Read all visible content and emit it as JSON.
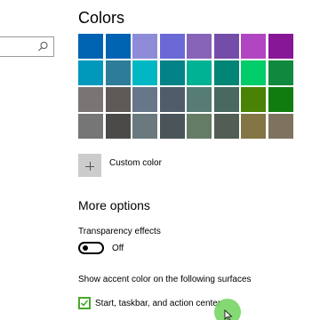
{
  "search": {
    "placeholder": "",
    "value": ""
  },
  "colors": {
    "title": "Colors",
    "swatches": [
      "#0063b1",
      "#0063b1",
      "#8e8cd8",
      "#6b69d6",
      "#8764b8",
      "#744da9",
      "#b146c2",
      "#881798",
      "#0099bc",
      "#2d7d9a",
      "#00b7c3",
      "#038387",
      "#00b294",
      "#018574",
      "#00cc6a",
      "#10893e",
      "#7a7574",
      "#5d5a58",
      "#68768a",
      "#515c6b",
      "#567c73",
      "#486860",
      "#498205",
      "#107c10",
      "#767676",
      "#4c4a48",
      "#69797e",
      "#4a5459",
      "#647c64",
      "#525e54",
      "#847545",
      "#7e735f"
    ],
    "selected_index": null
  },
  "custom_color": {
    "label": "Custom color"
  },
  "more_options": {
    "title": "More options",
    "transparency": {
      "label": "Transparency effects",
      "state_label": "Off",
      "on": false
    },
    "accent_surfaces": {
      "label": "Show accent color on the following surfaces",
      "start_taskbar": {
        "label": "Start, taskbar, and action center",
        "checked": true
      }
    }
  },
  "theme": {
    "checkbox_color": "#47a82f",
    "touch_indicator_color": "#6ed25a"
  }
}
